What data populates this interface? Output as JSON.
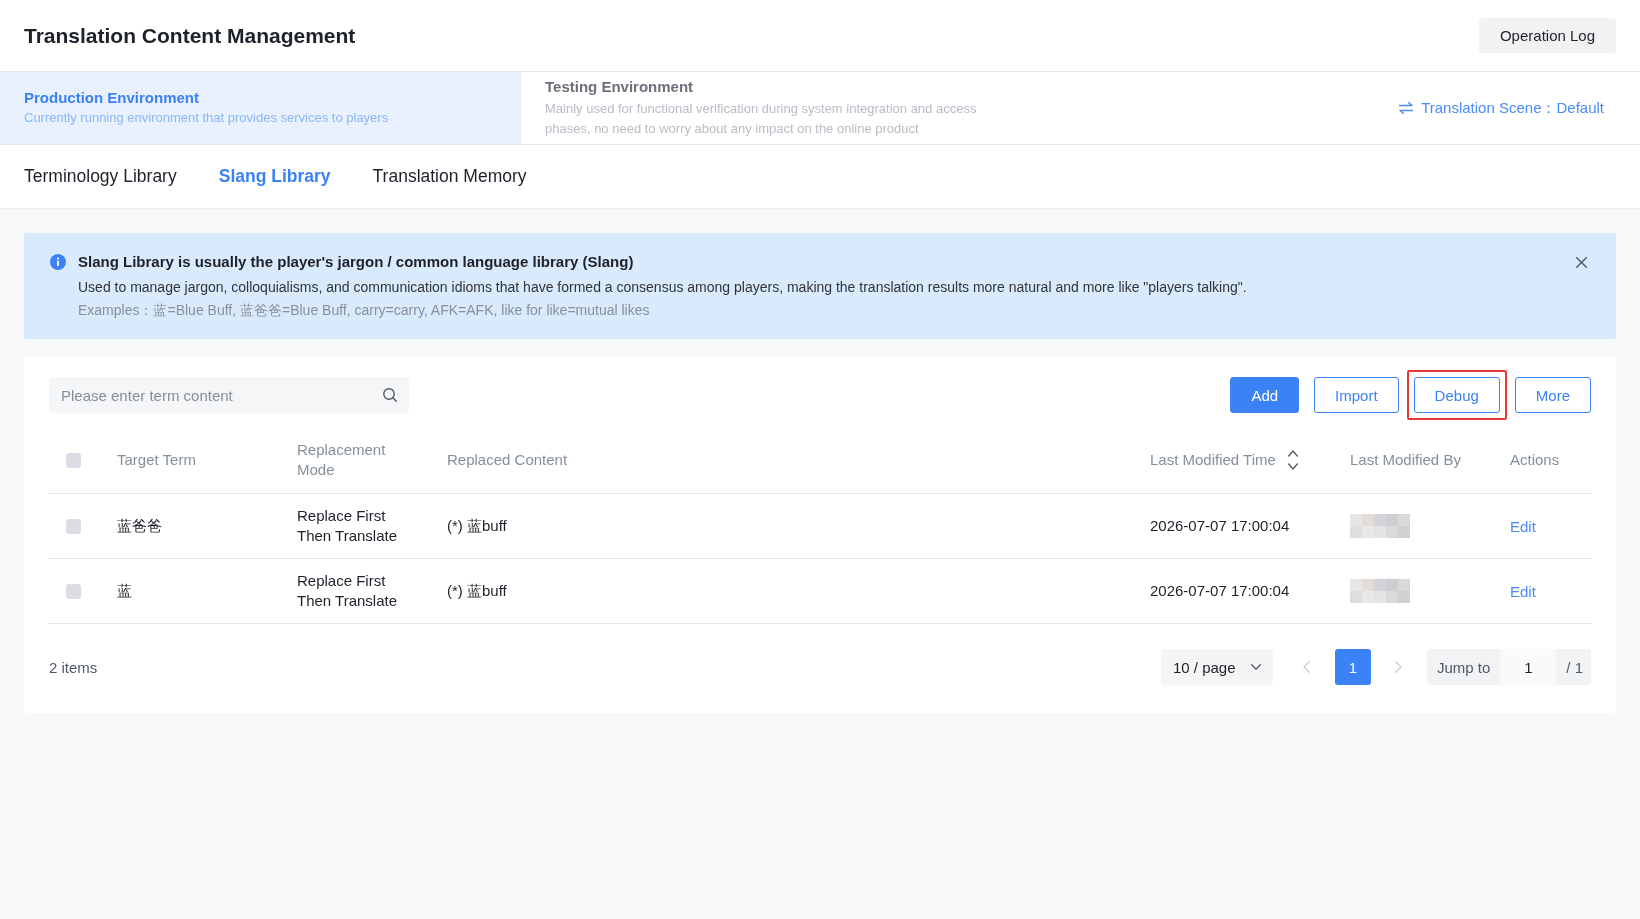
{
  "header": {
    "title": "Translation Content Management",
    "operation_log_button": "Operation Log"
  },
  "environments": [
    {
      "title": "Production Environment",
      "description": "Currently running environment that provides services to players",
      "selected": true
    },
    {
      "title": "Testing Environment",
      "description": "Mainly used for functional verification during system integration and access phases, no need to worry about any impact on the online product",
      "selected": false
    }
  ],
  "translation_scene": "Translation Scene：Default",
  "tabs": [
    {
      "label": "Terminology Library",
      "selected": false
    },
    {
      "label": "Slang Library",
      "selected": true
    },
    {
      "label": "Translation Memory",
      "selected": false
    }
  ],
  "notice": {
    "title": "Slang Library is usually the player's jargon / common language library (Slang)",
    "body": "Used to manage jargon, colloquialisms, and communication idioms that have formed a consensus among players, making the translation results more natural and more like \"players talking\".",
    "examples": "Examples：蓝=Blue Buff, 蓝爸爸=Blue Buff, carry=carry, AFK=AFK, like for like=mutual likes"
  },
  "toolbar": {
    "search": {
      "placeholder": "Please enter term content"
    },
    "buttons": [
      {
        "label": "Add",
        "kind": "primary",
        "highlighted": false
      },
      {
        "label": "Import",
        "kind": "outline",
        "highlighted": false
      },
      {
        "label": "Debug",
        "kind": "outline",
        "highlighted": true
      },
      {
        "label": "More",
        "kind": "outline",
        "highlighted": false
      }
    ]
  },
  "table": {
    "select_all_checked": false,
    "columns": [
      {
        "label": "Target Term",
        "sortable": false
      },
      {
        "label": "Replacement Mode",
        "sortable": false
      },
      {
        "label": "Replaced Content",
        "sortable": false
      },
      {
        "label": "Last Modified Time",
        "sortable": true
      },
      {
        "label": "Last Modified By",
        "sortable": false
      },
      {
        "label": "Actions",
        "sortable": false
      }
    ],
    "rows": [
      {
        "checked": false,
        "target_term": "蓝爸爸",
        "replacement_mode": "Replace First Then Translate",
        "replaced_content": "(*) 蓝buff",
        "last_modified_time": "2026-07-07 17:00:04",
        "modified_by_hidden": true,
        "action": "Edit"
      },
      {
        "checked": false,
        "target_term": "蓝",
        "replacement_mode": "Replace First Then Translate",
        "replaced_content": "(*) 蓝buff",
        "last_modified_time": "2026-07-07 17:00:04",
        "modified_by_hidden": true,
        "action": "Edit"
      }
    ]
  },
  "pagination": {
    "total": "2 items",
    "page_size": "10 / page",
    "prev_disabled": true,
    "pages": [
      {
        "label": "1",
        "selected": true
      }
    ],
    "next_disabled": true,
    "jump_label": "Jump to",
    "jump_value": "1",
    "page_count": "/ 1"
  }
}
